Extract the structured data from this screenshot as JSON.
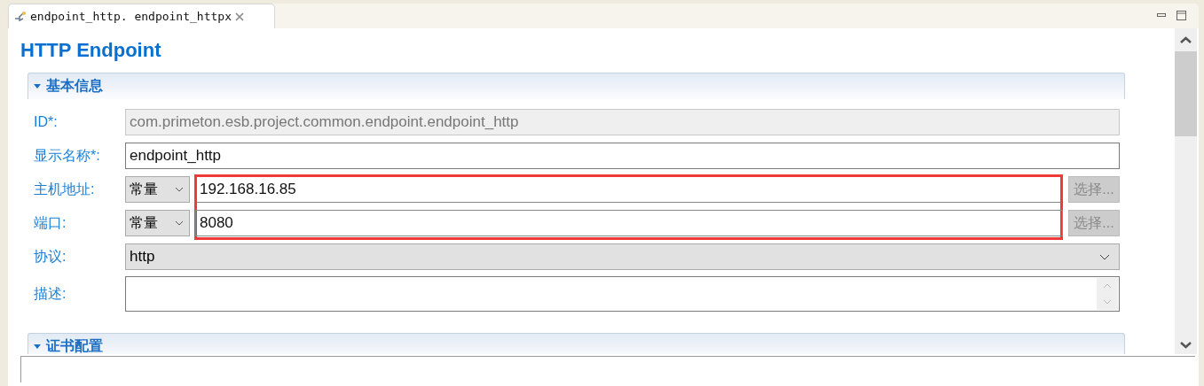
{
  "tab": {
    "title": "endpoint_http. endpoint_httpx"
  },
  "title": "HTTP Endpoint",
  "sections": [
    {
      "title": "基本信息",
      "expanded": true,
      "fields": [
        {
          "kind": "text",
          "label": "ID*:",
          "value": "com.primeton.esb.project.common.endpoint.endpoint_http",
          "disabled": true
        },
        {
          "kind": "text",
          "label": "显示名称*:",
          "value": "endpoint_http",
          "disabled": false
        },
        {
          "kind": "combo-text",
          "label": "主机地址:",
          "combo": "常量",
          "value": "192.168.16.85",
          "button": "选择...",
          "button_disabled": true,
          "highlighted": true
        },
        {
          "kind": "combo-text",
          "label": "端口:",
          "combo": "常量",
          "value": "8080",
          "button": "选择...",
          "button_disabled": true,
          "highlighted": true
        },
        {
          "kind": "select",
          "label": "协议:",
          "value": "http"
        },
        {
          "kind": "textarea",
          "label": "描述:"
        }
      ]
    },
    {
      "title": "证书配置",
      "expanded": true
    }
  ]
}
